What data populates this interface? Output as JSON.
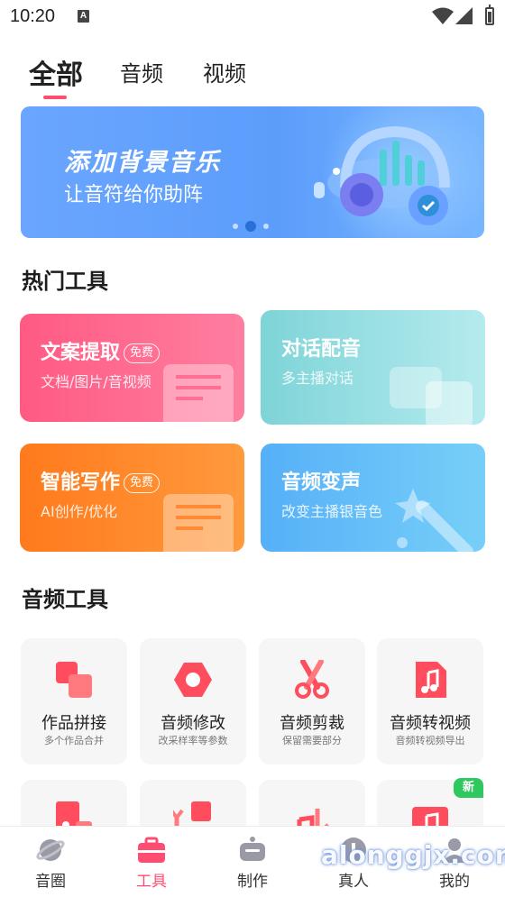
{
  "status_bar": {
    "time": "10:20",
    "notification_icon_letter": "A"
  },
  "top_tabs": [
    {
      "label": "全部",
      "active": true
    },
    {
      "label": "音频",
      "active": false
    },
    {
      "label": "视频",
      "active": false
    }
  ],
  "banner": {
    "title": "添加背景音乐",
    "subtitle": "让音符给你助阵",
    "page_index": 2,
    "page_count": 3
  },
  "hot_tools": {
    "title": "热门工具",
    "items": [
      {
        "name": "文案提取",
        "badge": "免费",
        "desc": "文档/图片/音视频",
        "color": "#ff5a83"
      },
      {
        "name": "对话配音",
        "badge": "",
        "desc": "多主播对话",
        "color": "#7ed4d8"
      },
      {
        "name": "智能写作",
        "badge": "免费",
        "desc": "AI创作/优化",
        "color": "#ff7a1c"
      },
      {
        "name": "音频变声",
        "badge": "",
        "desc": "改变主播银音色",
        "color": "#56b0f8"
      }
    ]
  },
  "audio_tools": {
    "title": "音频工具",
    "items": [
      {
        "name": "作品拼接",
        "desc": "多个作品合并",
        "icon": "merge-squares-icon"
      },
      {
        "name": "音频修改",
        "desc": "改采样率等参数",
        "icon": "hexagon-settings-icon"
      },
      {
        "name": "音频剪裁",
        "desc": "保留需要部分",
        "icon": "scissors-icon"
      },
      {
        "name": "音频转视频",
        "desc": "音频转视频导出",
        "icon": "music-file-icon"
      }
    ],
    "partial_row": [
      {
        "icon": "audio-file-icon",
        "badge": ""
      },
      {
        "icon": "convert-icon",
        "badge": ""
      },
      {
        "icon": "music-note-icon",
        "badge": ""
      },
      {
        "icon": "music-file-icon",
        "badge": "新"
      }
    ]
  },
  "bottom_nav": [
    {
      "label": "音圈",
      "icon": "planet-icon",
      "active": false
    },
    {
      "label": "工具",
      "icon": "toolbox-icon",
      "active": true
    },
    {
      "label": "制作",
      "icon": "robot-icon",
      "active": false
    },
    {
      "label": "真人",
      "icon": "person-icon",
      "active": false
    },
    {
      "label": "我的",
      "icon": "profile-icon",
      "active": false
    }
  ],
  "watermark": "alonggjx.com",
  "colors": {
    "accent": "#ff4d72",
    "new_badge": "#2ec85f",
    "banner": "#5c9dfb"
  }
}
